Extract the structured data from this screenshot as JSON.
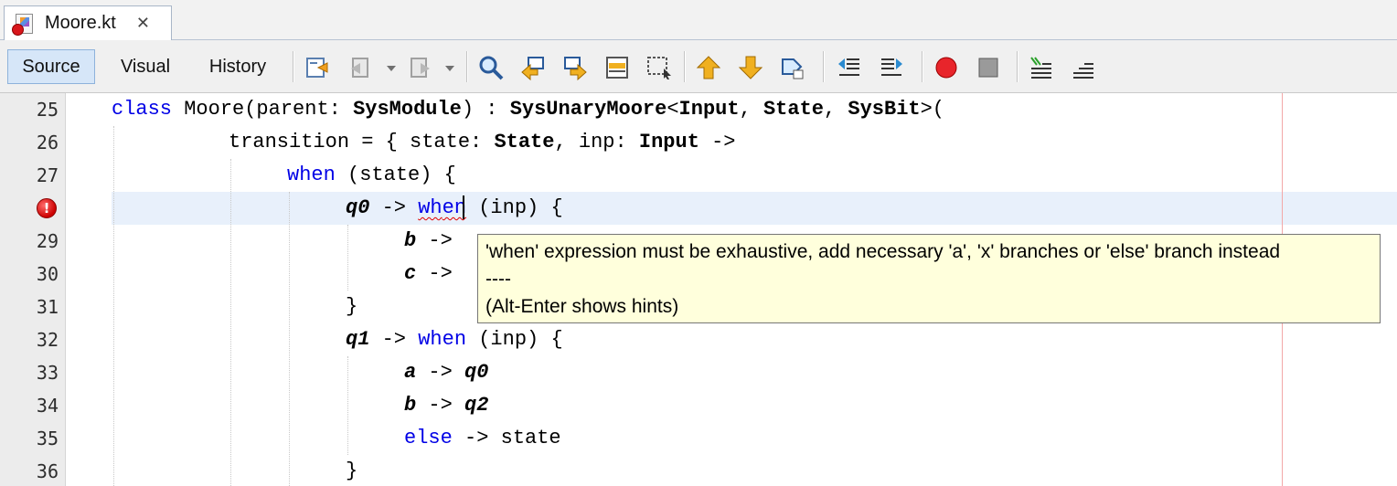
{
  "tab": {
    "title": "Moore.kt",
    "close_glyph": "✕",
    "icon": "kotlin-file-error-icon"
  },
  "toolbar": {
    "source_label": "Source",
    "visual_label": "Visual",
    "history_label": "History",
    "icons": [
      "last-edit-icon",
      "back-icon",
      "forward-icon",
      "find-icon",
      "find-previous-icon",
      "find-next-icon",
      "toggle-highlight-icon",
      "find-selection-icon",
      "previous-bookmark-icon",
      "next-bookmark-icon",
      "toggle-bookmark-icon",
      "shift-left-icon",
      "shift-right-icon",
      "start-macro-icon",
      "stop-macro-icon",
      "comment-icon",
      "uncomment-icon"
    ]
  },
  "gutter": {
    "lines": [
      "25",
      "26",
      "27",
      "",
      "29",
      "30",
      "31",
      "32",
      "33",
      "34",
      "35",
      "36"
    ],
    "error_line": "28"
  },
  "code": {
    "line25": {
      "kw_class": "class",
      "name": " Moore(parent: ",
      "t1": "SysModule",
      "colon": ") : ",
      "t2": "SysUnaryMoore",
      "lt": "<",
      "t3": "Input",
      "c1": ", ",
      "t4": "State",
      "c2": ", ",
      "t5": "SysBit",
      "gt": ">("
    },
    "line26": {
      "a": "transition = { state: ",
      "t1": "State",
      "b": ", inp: ",
      "t2": "Input",
      "c": " ->"
    },
    "line27": {
      "kw": "when",
      "rest": " (state) {"
    },
    "line28": {
      "q": "q0",
      "arrow": " -> ",
      "kw_a": "wh",
      "kw_b": "en",
      "rest": " (inp) {"
    },
    "line29": {
      "v": "b",
      "arrow": " ->"
    },
    "line30": {
      "v": "c",
      "arrow": " ->"
    },
    "line31": {
      "brace": "}"
    },
    "line32": {
      "q": "q1",
      "arrow": " -> ",
      "kw": "when",
      "rest": " (inp) {"
    },
    "line33": {
      "v": "a",
      "arrow": " -> ",
      "q": "q0"
    },
    "line34": {
      "v": "b",
      "arrow": " -> ",
      "q": "q2"
    },
    "line35": {
      "kw": "else",
      "rest": " -> state"
    },
    "line36": {
      "brace": "}"
    }
  },
  "tooltip": {
    "message": "'when' expression must be exhaustive, add necessary 'a', 'x' branches or 'else' branch instead",
    "separator": "----",
    "hint": "(Alt-Enter shows hints)"
  },
  "colors": {
    "keyword": "#0000e6",
    "tooltip_bg": "#ffffdc",
    "current_line": "#e8f0fb",
    "error": "#d8161b",
    "margin_line": "#f3a7a7"
  }
}
